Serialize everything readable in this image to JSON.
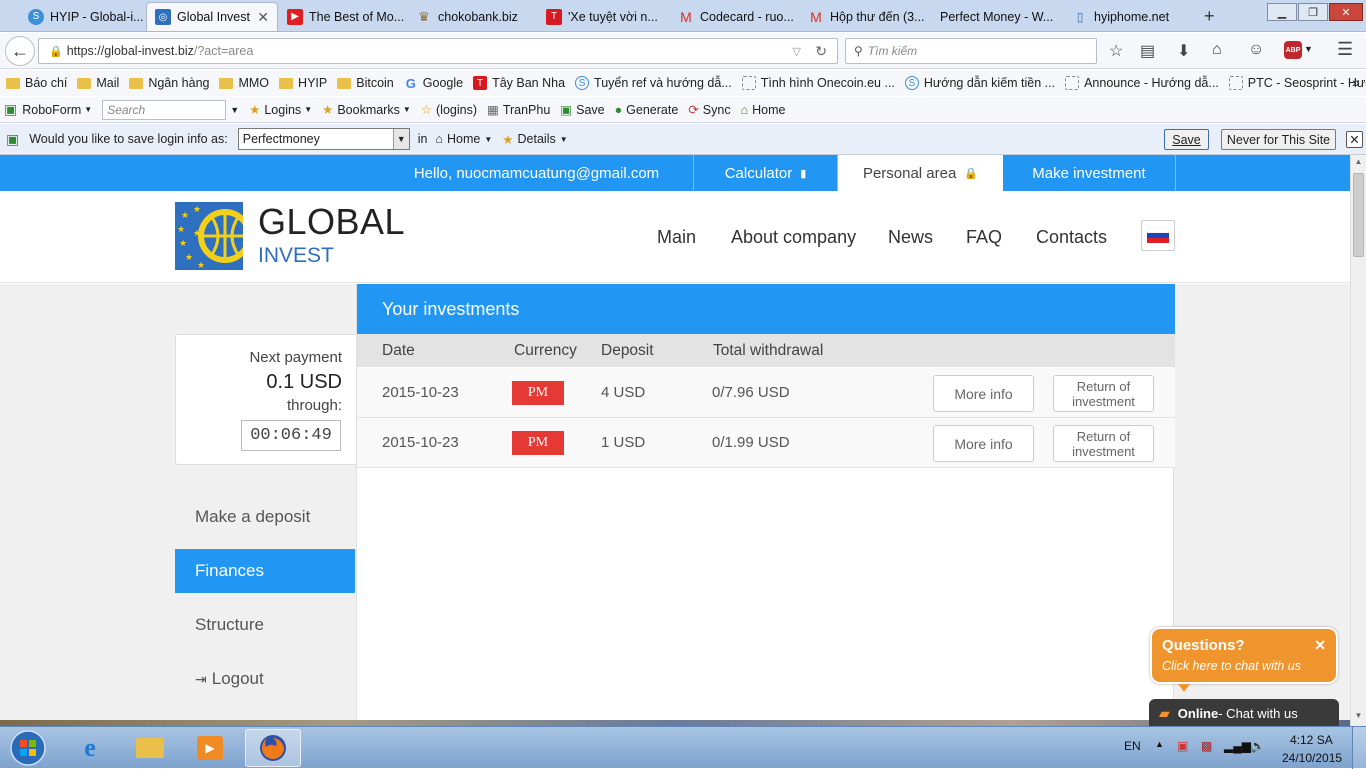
{
  "browser": {
    "tabs": [
      {
        "title": "HYIP - Global-i...",
        "active": false
      },
      {
        "title": "Global Invest",
        "active": true
      },
      {
        "title": "The Best of Mo...",
        "active": false
      },
      {
        "title": "chokobank.biz",
        "active": false
      },
      {
        "title": "'Xe tuyệt vời n...",
        "active": false
      },
      {
        "title": "Codecard - ruo...",
        "active": false
      },
      {
        "title": "Hộp thư đến (3...",
        "active": false
      },
      {
        "title": "Perfect Money - W...",
        "active": false
      },
      {
        "title": "hyiphome.net",
        "active": false
      }
    ],
    "new_tab": "+",
    "url": "https://global-invest.biz/?act=area",
    "url_host": "https://global-invest.biz",
    "url_path": "/?act=area",
    "search_placeholder": "Tìm kiếm",
    "abp_label": "ABP"
  },
  "bookmarks": [
    {
      "label": "Báo chí",
      "icon": "folder"
    },
    {
      "label": "Mail",
      "icon": "folder"
    },
    {
      "label": "Ngân hàng",
      "icon": "folder"
    },
    {
      "label": "MMO",
      "icon": "folder"
    },
    {
      "label": "HYIP",
      "icon": "folder"
    },
    {
      "label": "Bitcoin",
      "icon": "folder"
    },
    {
      "label": "Google",
      "icon": "google"
    },
    {
      "label": "Tây Ban Nha",
      "icon": "t-red"
    },
    {
      "label": "Tuyển ref và hướng dẫ...",
      "icon": "s-blue"
    },
    {
      "label": "Tình hình Onecoin.eu ...",
      "icon": "blank"
    },
    {
      "label": "Hướng dẫn kiếm tiền ...",
      "icon": "s-blue"
    },
    {
      "label": "Announce - Hướng dẫ...",
      "icon": "blank"
    },
    {
      "label": "PTC - Seosprint - Hướ...",
      "icon": "blank"
    }
  ],
  "bookmarks_more": "»",
  "roboform": {
    "brand": "RoboForm",
    "search_placeholder": "Search",
    "items": [
      "Logins",
      "Bookmarks",
      "(logins)",
      "TranPhu",
      "Save",
      "Generate",
      "Sync",
      "Home"
    ]
  },
  "save_prompt": {
    "question": "Would you like to save login info as:",
    "value": "Perfectmoney",
    "in_label": "in",
    "folder": "Home",
    "details": "Details",
    "save_button": "Save",
    "never_button": "Never for This Site",
    "close": "✕"
  },
  "site": {
    "top": {
      "hello": "Hello, nuocmamcuatung@gmail.com",
      "calculator": "Calculator",
      "personal": "Personal area",
      "make_investment": "Make investment"
    },
    "logo": {
      "line1": "GLOBAL",
      "line2": "INVEST"
    },
    "nav": [
      "Main",
      "About company",
      "News",
      "FAQ",
      "Contacts"
    ],
    "next_payment": {
      "label": "Next payment",
      "amount": "0.1 USD",
      "through": "through:",
      "timer": "00:06:49"
    },
    "sidebar": [
      "Make a deposit",
      "Finances",
      "Structure",
      "Logout"
    ],
    "active_sidebar": "Finances",
    "investments": {
      "title": "Your investments",
      "headers": [
        "Date",
        "Currency",
        "Deposit",
        "Total withdrawal"
      ],
      "rows": [
        {
          "date": "2015-10-23",
          "currency": "PM",
          "deposit": "4 USD",
          "withdrawal": "0/7.96 USD",
          "more": "More info",
          "return": "Return of investment"
        },
        {
          "date": "2015-10-23",
          "currency": "PM",
          "deposit": "1 USD",
          "withdrawal": "0/1.99 USD",
          "more": "More info",
          "return": "Return of investment"
        }
      ]
    },
    "chat": {
      "question": "Questions?",
      "sub": "Click here to chat with us",
      "close": "✕",
      "online": "Online",
      "online_rest": " - Chat with us"
    }
  },
  "taskbar": {
    "lang": "EN",
    "time": "4:12 SA",
    "date": "24/10/2015"
  },
  "colors": {
    "accent": "#2196f3",
    "pm": "#e53935",
    "chat": "#f0952e"
  }
}
